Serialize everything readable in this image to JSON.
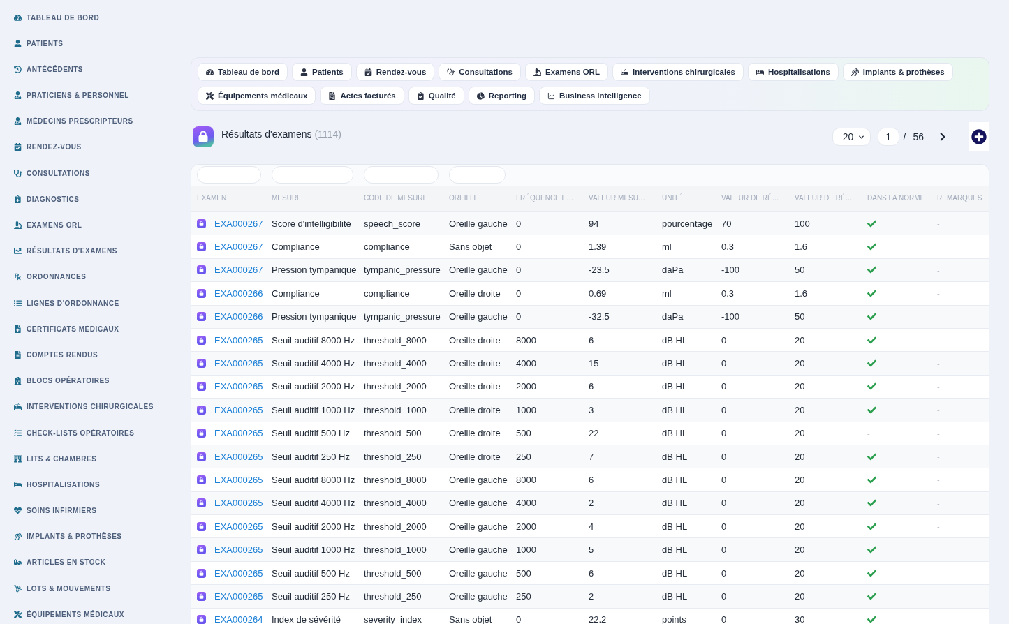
{
  "sidebar": {
    "items": [
      {
        "label": "TABLEAU DE BORD"
      },
      {
        "label": "PATIENTS"
      },
      {
        "label": "ANTÉCÉDENTS"
      },
      {
        "label": "PRATICIENS & PERSONNEL"
      },
      {
        "label": "MÉDECINS PRESCRIPTEURS"
      },
      {
        "label": "RENDEZ-VOUS"
      },
      {
        "label": "CONSULTATIONS"
      },
      {
        "label": "DIAGNOSTICS"
      },
      {
        "label": "EXAMENS ORL"
      },
      {
        "label": "RÉSULTATS D'EXAMENS"
      },
      {
        "label": "ORDONNANCES"
      },
      {
        "label": "LIGNES D'ORDONNANCE"
      },
      {
        "label": "CERTIFICATS MÉDICAUX"
      },
      {
        "label": "COMPTES RENDUS"
      },
      {
        "label": "BLOCS OPÉRATOIRES"
      },
      {
        "label": "INTERVENTIONS CHIRURGICALES"
      },
      {
        "label": "CHECK-LISTS OPÉRATOIRES"
      },
      {
        "label": "LITS & CHAMBRES"
      },
      {
        "label": "HOSPITALISATIONS"
      },
      {
        "label": "SOINS INFIRMIERS"
      },
      {
        "label": "IMPLANTS & PROTHÈSES"
      },
      {
        "label": "ARTICLES EN STOCK"
      },
      {
        "label": "LOTS & MOUVEMENTS"
      },
      {
        "label": "ÉQUIPEMENTS MÉDICAUX"
      }
    ]
  },
  "tabs": [
    {
      "label": "Tableau de bord"
    },
    {
      "label": "Patients"
    },
    {
      "label": "Rendez-vous"
    },
    {
      "label": "Consultations"
    },
    {
      "label": "Examens ORL"
    },
    {
      "label": "Interventions chirurgicales"
    },
    {
      "label": "Hospitalisations"
    },
    {
      "label": "Implants & prothèses"
    },
    {
      "label": "Équipements médicaux"
    },
    {
      "label": "Actes facturés"
    },
    {
      "label": "Qualité"
    },
    {
      "label": "Reporting"
    },
    {
      "label": "Business Intelligence"
    }
  ],
  "header": {
    "title": "Résultats d'examens",
    "count": "(1114)"
  },
  "pagination": {
    "page_size": "20",
    "page": "1",
    "separator": "/",
    "total_pages": "56"
  },
  "table": {
    "filters": [
      {
        "kind": "text"
      },
      {
        "kind": "text"
      },
      {
        "kind": "text"
      },
      {
        "kind": "text"
      }
    ],
    "columns": [
      "EXAMEN",
      "MESURE",
      "CODE DE MESURE",
      "OREILLE",
      "FRÉQUENCE E…",
      "VALEUR MESU…",
      "UNITÉ",
      "VALEUR DE RÉ…",
      "VALEUR DE RÉ…",
      "DANS LA NORME",
      "REMARQUES"
    ],
    "rows": [
      {
        "examen": "EXA000267",
        "mesure": "Score d'intelligibilité",
        "code_de_mesure": "speech_score",
        "oreille": "Oreille gauche",
        "column_5": "0",
        "column_6": "94",
        "unite": "pourcentage",
        "column_8": "70",
        "column_9": "100",
        "dans_la_norme": true,
        "remarques": "-"
      },
      {
        "examen": "EXA000267",
        "mesure": "Compliance",
        "code_de_mesure": "compliance",
        "oreille": "Sans objet",
        "column_5": "0",
        "column_6": "1.39",
        "unite": "ml",
        "column_8": "0.3",
        "column_9": "1.6",
        "dans_la_norme": true,
        "remarques": "-"
      },
      {
        "examen": "EXA000267",
        "mesure": "Pression tympanique",
        "code_de_mesure": "tympanic_pressure",
        "oreille": "Oreille gauche",
        "column_5": "0",
        "column_6": "-23.5",
        "unite": "daPa",
        "column_8": "-100",
        "column_9": "50",
        "dans_la_norme": true,
        "remarques": "-"
      },
      {
        "examen": "EXA000266",
        "mesure": "Compliance",
        "code_de_mesure": "compliance",
        "oreille": "Oreille droite",
        "column_5": "0",
        "column_6": "0.69",
        "unite": "ml",
        "column_8": "0.3",
        "column_9": "1.6",
        "dans_la_norme": true,
        "remarques": "-"
      },
      {
        "examen": "EXA000266",
        "mesure": "Pression tympanique",
        "code_de_mesure": "tympanic_pressure",
        "oreille": "Oreille gauche",
        "column_5": "0",
        "column_6": "-32.5",
        "unite": "daPa",
        "column_8": "-100",
        "column_9": "50",
        "dans_la_norme": true,
        "remarques": "-"
      },
      {
        "examen": "EXA000265",
        "mesure": "Seuil auditif 8000 Hz",
        "code_de_mesure": "threshold_8000",
        "oreille": "Oreille droite",
        "column_5": "8000",
        "column_6": "6",
        "unite": "dB HL",
        "column_8": "0",
        "column_9": "20",
        "dans_la_norme": true,
        "remarques": "-"
      },
      {
        "examen": "EXA000265",
        "mesure": "Seuil auditif 4000 Hz",
        "code_de_mesure": "threshold_4000",
        "oreille": "Oreille droite",
        "column_5": "4000",
        "column_6": "15",
        "unite": "dB HL",
        "column_8": "0",
        "column_9": "20",
        "dans_la_norme": true,
        "remarques": "-"
      },
      {
        "examen": "EXA000265",
        "mesure": "Seuil auditif 2000 Hz",
        "code_de_mesure": "threshold_2000",
        "oreille": "Oreille droite",
        "column_5": "2000",
        "column_6": "6",
        "unite": "dB HL",
        "column_8": "0",
        "column_9": "20",
        "dans_la_norme": true,
        "remarques": "-"
      },
      {
        "examen": "EXA000265",
        "mesure": "Seuil auditif 1000 Hz",
        "code_de_mesure": "threshold_1000",
        "oreille": "Oreille droite",
        "column_5": "1000",
        "column_6": "3",
        "unite": "dB HL",
        "column_8": "0",
        "column_9": "20",
        "dans_la_norme": true,
        "remarques": "-"
      },
      {
        "examen": "EXA000265",
        "mesure": "Seuil auditif 500 Hz",
        "code_de_mesure": "threshold_500",
        "oreille": "Oreille droite",
        "column_5": "500",
        "column_6": "22",
        "unite": "dB HL",
        "column_8": "0",
        "column_9": "20",
        "dans_la_norme": false,
        "dans_la_norme_text": "-",
        "remarques": "-"
      },
      {
        "examen": "EXA000265",
        "mesure": "Seuil auditif 250 Hz",
        "code_de_mesure": "threshold_250",
        "oreille": "Oreille droite",
        "column_5": "250",
        "column_6": "7",
        "unite": "dB HL",
        "column_8": "0",
        "column_9": "20",
        "dans_la_norme": true,
        "remarques": "-"
      },
      {
        "examen": "EXA000265",
        "mesure": "Seuil auditif 8000 Hz",
        "code_de_mesure": "threshold_8000",
        "oreille": "Oreille gauche",
        "column_5": "8000",
        "column_6": "6",
        "unite": "dB HL",
        "column_8": "0",
        "column_9": "20",
        "dans_la_norme": true,
        "remarques": "-"
      },
      {
        "examen": "EXA000265",
        "mesure": "Seuil auditif 4000 Hz",
        "code_de_mesure": "threshold_4000",
        "oreille": "Oreille gauche",
        "column_5": "4000",
        "column_6": "2",
        "unite": "dB HL",
        "column_8": "0",
        "column_9": "20",
        "dans_la_norme": true,
        "remarques": "-"
      },
      {
        "examen": "EXA000265",
        "mesure": "Seuil auditif 2000 Hz",
        "code_de_mesure": "threshold_2000",
        "oreille": "Oreille gauche",
        "column_5": "2000",
        "column_6": "4",
        "unite": "dB HL",
        "column_8": "0",
        "column_9": "20",
        "dans_la_norme": true,
        "remarques": "-"
      },
      {
        "examen": "EXA000265",
        "mesure": "Seuil auditif 1000 Hz",
        "code_de_mesure": "threshold_1000",
        "oreille": "Oreille gauche",
        "column_5": "1000",
        "column_6": "5",
        "unite": "dB HL",
        "column_8": "0",
        "column_9": "20",
        "dans_la_norme": true,
        "remarques": "-"
      },
      {
        "examen": "EXA000265",
        "mesure": "Seuil auditif 500 Hz",
        "code_de_mesure": "threshold_500",
        "oreille": "Oreille gauche",
        "column_5": "500",
        "column_6": "6",
        "unite": "dB HL",
        "column_8": "0",
        "column_9": "20",
        "dans_la_norme": true,
        "remarques": "-"
      },
      {
        "examen": "EXA000265",
        "mesure": "Seuil auditif 250 Hz",
        "code_de_mesure": "threshold_250",
        "oreille": "Oreille gauche",
        "column_5": "250",
        "column_6": "2",
        "unite": "dB HL",
        "column_8": "0",
        "column_9": "20",
        "dans_la_norme": true,
        "remarques": "-"
      },
      {
        "examen": "EXA000264",
        "mesure": "Index de sévérité",
        "code_de_mesure": "severity_index",
        "oreille": "Sans objet",
        "column_5": "0",
        "column_6": "22.2",
        "unite": "points",
        "column_8": "0",
        "column_9": "30",
        "dans_la_norme": true,
        "remarques": "-"
      }
    ]
  }
}
